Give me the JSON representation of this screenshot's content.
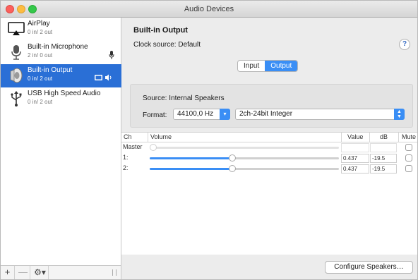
{
  "window": {
    "title": "Audio Devices"
  },
  "sidebar": {
    "devices": [
      {
        "name": "AirPlay",
        "io": "0 in/ 2 out",
        "icon": "airplay-icon"
      },
      {
        "name": "Built-in Microphone",
        "io": "2 in/ 0 out",
        "icon": "microphone-icon"
      },
      {
        "name": "Built-in Output",
        "io": "0 in/ 2 out",
        "icon": "speaker-icon",
        "selected": true
      },
      {
        "name": "USB High Speed Audio",
        "io": "0 in/ 2 out",
        "icon": "usb-icon"
      }
    ],
    "toolbar": {
      "add": "+",
      "remove": "—",
      "gear": "⚙▾"
    }
  },
  "main": {
    "device_title": "Built-in Output",
    "clock_source": "Clock source:  Default",
    "help": "?",
    "tabs": [
      {
        "label": "Input"
      },
      {
        "label": "Output",
        "active": true
      }
    ],
    "source": "Source:  Internal Speakers",
    "format_label": "Format:",
    "sample_rate": "44100,0 Hz",
    "bit_format": "2ch-24bit Integer",
    "table": {
      "headers": {
        "ch": "Ch",
        "volume": "Volume",
        "value": "Value",
        "db": "dB",
        "mute": "Mute"
      },
      "rows": [
        {
          "label": "Master",
          "level": 0.0,
          "value": "",
          "db": "",
          "mute": false,
          "enabled": false
        },
        {
          "label": "1:",
          "level": 0.437,
          "value": "0.437",
          "db": "-19.5",
          "mute": false,
          "enabled": true
        },
        {
          "label": "2:",
          "level": 0.437,
          "value": "0.437",
          "db": "-19.5",
          "mute": false,
          "enabled": true
        }
      ]
    },
    "configure_button": "Configure Speakers…"
  },
  "colors": {
    "accent": "#3a8ef5",
    "selection": "#2a6fd6"
  }
}
